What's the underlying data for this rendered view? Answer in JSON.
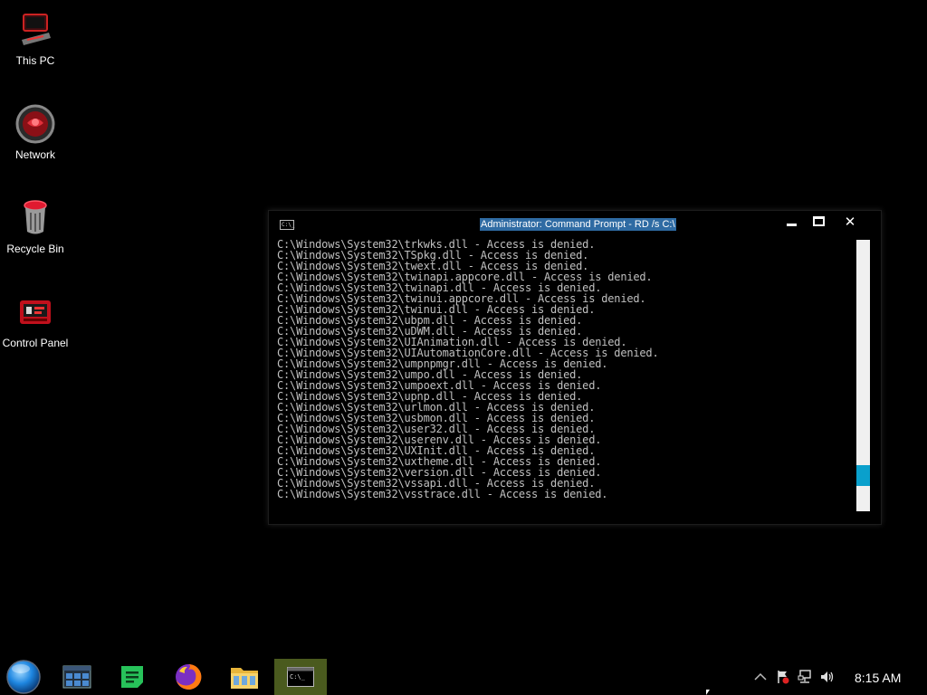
{
  "desktop": {
    "icons": [
      {
        "label": "This PC",
        "icon": "computer-icon"
      },
      {
        "label": "Network",
        "icon": "network-icon"
      },
      {
        "label": "Recycle Bin",
        "icon": "recycle-bin-icon"
      },
      {
        "label": "Control Panel",
        "icon": "control-panel-icon"
      }
    ]
  },
  "console": {
    "title": "Administrator: Command Prompt - RD  /s C:\\",
    "app_icon_text": "C:\\_",
    "close_glyph": "✕",
    "lines": [
      "C:\\Windows\\System32\\trkwks.dll - Access is denied.",
      "C:\\Windows\\System32\\TSpkg.dll - Access is denied.",
      "C:\\Windows\\System32\\twext.dll - Access is denied.",
      "C:\\Windows\\System32\\twinapi.appcore.dll - Access is denied.",
      "C:\\Windows\\System32\\twinapi.dll - Access is denied.",
      "C:\\Windows\\System32\\twinui.appcore.dll - Access is denied.",
      "C:\\Windows\\System32\\twinui.dll - Access is denied.",
      "C:\\Windows\\System32\\ubpm.dll - Access is denied.",
      "C:\\Windows\\System32\\uDWM.dll - Access is denied.",
      "C:\\Windows\\System32\\UIAnimation.dll - Access is denied.",
      "C:\\Windows\\System32\\UIAutomationCore.dll - Access is denied.",
      "C:\\Windows\\System32\\umpnpmgr.dll - Access is denied.",
      "C:\\Windows\\System32\\umpo.dll - Access is denied.",
      "C:\\Windows\\System32\\umpoext.dll - Access is denied.",
      "C:\\Windows\\System32\\upnp.dll - Access is denied.",
      "C:\\Windows\\System32\\urlmon.dll - Access is denied.",
      "C:\\Windows\\System32\\usbmon.dll - Access is denied.",
      "C:\\Windows\\System32\\user32.dll - Access is denied.",
      "C:\\Windows\\System32\\userenv.dll - Access is denied.",
      "C:\\Windows\\System32\\UXInit.dll - Access is denied.",
      "C:\\Windows\\System32\\uxtheme.dll - Access is denied.",
      "C:\\Windows\\System32\\version.dll - Access is denied.",
      "C:\\Windows\\System32\\vssapi.dll - Access is denied.",
      "C:\\Windows\\System32\\vsstrace.dll - Access is denied."
    ],
    "scroll_position": 0.9,
    "scroll_thumb_fraction": 0.075,
    "colors": {
      "text": "#c0c0c0",
      "title_highlight": "#2f6ba3",
      "scroll_thumb": "#0aa0cc"
    }
  },
  "taskbar": {
    "items": [
      {
        "icon": "start-orb-icon",
        "active": false
      },
      {
        "icon": "task-view-icon",
        "active": false
      },
      {
        "icon": "notes-app-icon",
        "active": false
      },
      {
        "icon": "firefox-icon",
        "active": false
      },
      {
        "icon": "file-explorer-icon",
        "active": false
      },
      {
        "icon": "command-prompt-icon",
        "active": true
      }
    ],
    "tray": {
      "icons": [
        "show-hidden-icons-chevron-icon",
        "action-center-flag-icon",
        "network-status-icon",
        "volume-icon"
      ],
      "clock": "8:15 AM"
    },
    "colors": {
      "active_item": "#4a5a1e"
    }
  }
}
